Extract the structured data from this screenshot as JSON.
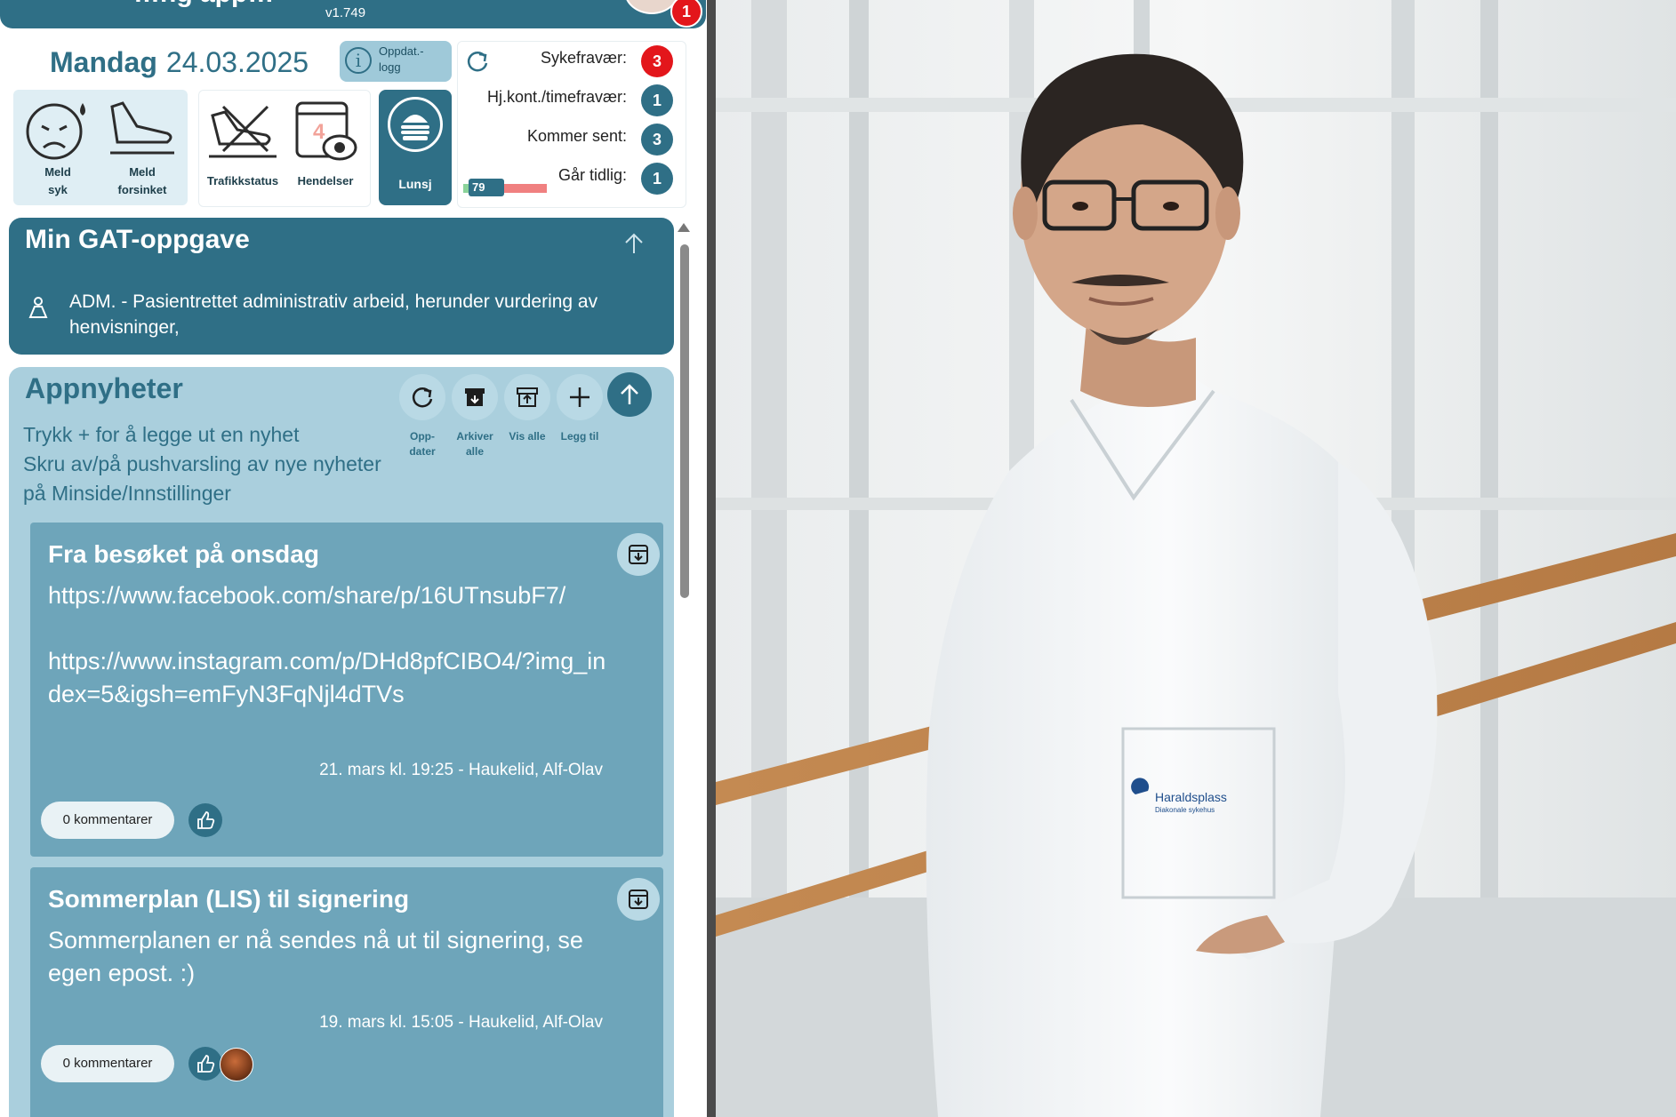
{
  "header": {
    "title_fragment": "…ng app…",
    "version": "v1.749",
    "avatar_badge": "1"
  },
  "date": {
    "weekday": "Mandag",
    "date": "24.03.2025"
  },
  "update_log": {
    "label": "Oppdat.-\nlogg"
  },
  "quick_actions": [
    {
      "label": "Meld\nsyk",
      "icon": "sick-face-icon"
    },
    {
      "label": "Meld\nforsinket",
      "icon": "delayed-travel-icon"
    },
    {
      "label": "Trafikkstatus",
      "icon": "traffic-status-icon"
    },
    {
      "label": "Hendelser",
      "icon": "events-calendar-icon",
      "overlay": "4"
    },
    {
      "label": "Lunsj",
      "icon": "burger-icon"
    }
  ],
  "stats": [
    {
      "label": "Sykefravær:",
      "value": "3",
      "color": "#e3161b"
    },
    {
      "label": "Hj.kont./timefravær:",
      "value": "1",
      "color": "#2f6f86"
    },
    {
      "label": "Kommer sent:",
      "value": "3",
      "color": "#2f6f86"
    },
    {
      "label": "Går tidlig:",
      "value": "1",
      "color": "#2f6f86"
    }
  ],
  "progress": {
    "value": "79",
    "fraction": 0.4
  },
  "gat": {
    "title": "Min GAT-oppgave",
    "description": "ADM. - Pasientrettet administrativ arbeid, herunder vurdering av henvisninger,"
  },
  "news": {
    "title": "Appnyheter",
    "help_lines": [
      "Trykk + for å legge ut en nyhet",
      "Skru av/på pushvarsling av nye nyheter",
      "på Minside/Innstillinger"
    ],
    "tools": [
      {
        "label": "Opp-\ndater",
        "icon": "refresh-icon"
      },
      {
        "label": "Arkiver\nalle",
        "icon": "archive-all-icon"
      },
      {
        "label": "Vis alle",
        "icon": "unarchive-icon"
      },
      {
        "label": "Legg til",
        "icon": "plus-icon"
      }
    ],
    "posts": [
      {
        "title": "Fra besøket på onsdag",
        "body": "https://www.facebook.com/share/p/16UTnsubF7/\n\nhttps://www.instagram.com/p/DHd8pfCIBO4/?img_index=5&igsh=emFyN3FqNjl4dTVs",
        "meta": "21. mars kl. 19:25 - Haukelid, Alf-Olav",
        "comments": "0 kommentarer"
      },
      {
        "title": "Sommerplan (LIS) til signering",
        "body": "Sommerplanen er nå sendes nå ut til signering, se egen epost. :)",
        "meta": "19. mars kl. 15:05 - Haukelid, Alf-Olav",
        "comments": "0 kommentarer"
      }
    ]
  },
  "photo": {
    "pocket_logo_line1": "Haraldsplass",
    "pocket_logo_line2": "Diakonale sykehus"
  }
}
